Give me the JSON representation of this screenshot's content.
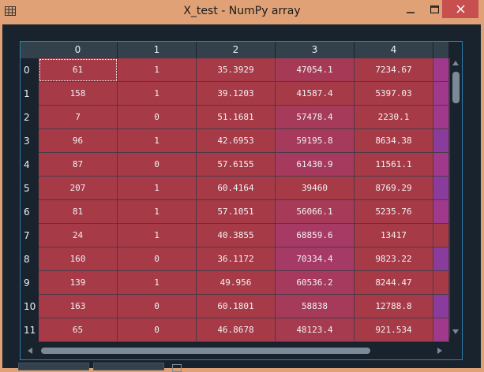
{
  "window": {
    "title": "X_test - NumPy array",
    "min_icon": "minimize-icon",
    "max_icon": "maximize-icon",
    "close_icon": "close-icon"
  },
  "table": {
    "columns": [
      "0",
      "1",
      "2",
      "3",
      "4"
    ],
    "rows": [
      {
        "index": "0",
        "cells": [
          "61",
          "1",
          "35.3929",
          "47054.1",
          "7234.67"
        ]
      },
      {
        "index": "1",
        "cells": [
          "158",
          "1",
          "39.1203",
          "41587.4",
          "5397.03"
        ]
      },
      {
        "index": "2",
        "cells": [
          "7",
          "0",
          "51.1681",
          "57478.4",
          "2230.1"
        ]
      },
      {
        "index": "3",
        "cells": [
          "96",
          "1",
          "42.6953",
          "59195.8",
          "8634.38"
        ]
      },
      {
        "index": "4",
        "cells": [
          "87",
          "0",
          "57.6155",
          "61430.9",
          "11561.1"
        ]
      },
      {
        "index": "5",
        "cells": [
          "207",
          "1",
          "60.4164",
          "39460",
          "8769.29"
        ]
      },
      {
        "index": "6",
        "cells": [
          "81",
          "1",
          "57.1051",
          "56066.1",
          "5235.76"
        ]
      },
      {
        "index": "7",
        "cells": [
          "24",
          "1",
          "40.3855",
          "68859.6",
          "13417"
        ]
      },
      {
        "index": "8",
        "cells": [
          "160",
          "0",
          "36.1172",
          "70334.4",
          "9823.22"
        ]
      },
      {
        "index": "9",
        "cells": [
          "139",
          "1",
          "49.956",
          "60536.2",
          "8244.47"
        ]
      },
      {
        "index": "10",
        "cells": [
          "163",
          "0",
          "60.1801",
          "58838",
          "12788.8"
        ]
      },
      {
        "index": "11",
        "cells": [
          "65",
          "0",
          "46.8678",
          "48123.4",
          "921.534"
        ]
      }
    ],
    "cell_colors": [
      [
        "#a63a47",
        "#a63a47",
        "#a63a47",
        "#a63a56",
        "#a63a47",
        "#a0398c"
      ],
      [
        "#a63a47",
        "#a63a47",
        "#a63a47",
        "#a63a47",
        "#a63a47",
        "#a0398c"
      ],
      [
        "#a63a47",
        "#a63a47",
        "#a63a47",
        "#a63a5a",
        "#a63a47",
        "#a0398c"
      ],
      [
        "#a63a47",
        "#a63a47",
        "#a63a47",
        "#a63a5c",
        "#a63a47",
        "#8a3c9c"
      ],
      [
        "#a63a47",
        "#a63a47",
        "#a63a47",
        "#a63a5e",
        "#a63a47",
        "#a0398c"
      ],
      [
        "#a63a47",
        "#a63a47",
        "#a63a47",
        "#a63a47",
        "#a63a47",
        "#8a3c9c"
      ],
      [
        "#a63a47",
        "#a63a47",
        "#a63a47",
        "#a63a58",
        "#a63a47",
        "#a0398c"
      ],
      [
        "#a63a47",
        "#a63a47",
        "#a63a47",
        "#a63a64",
        "#a63a47",
        "#a63a47"
      ],
      [
        "#a63a47",
        "#a63a47",
        "#a63a47",
        "#a63a66",
        "#a63a47",
        "#8a3c9c"
      ],
      [
        "#a63a47",
        "#a63a47",
        "#a63a47",
        "#a63a5e",
        "#a63a47",
        "#a63a47"
      ],
      [
        "#a63a47",
        "#a63a47",
        "#a63a47",
        "#a63a5a",
        "#a63a47",
        "#8a3c9c"
      ],
      [
        "#a63a47",
        "#a63a47",
        "#a63a47",
        "#a63a4e",
        "#a63a47",
        "#a0398c"
      ]
    ],
    "selected_cell": [
      0,
      0
    ]
  },
  "colors": {
    "accent_border": "#2d7fb0",
    "header_bg": "#32414b",
    "background": "#19232d",
    "titlebar": "#e0a176"
  }
}
